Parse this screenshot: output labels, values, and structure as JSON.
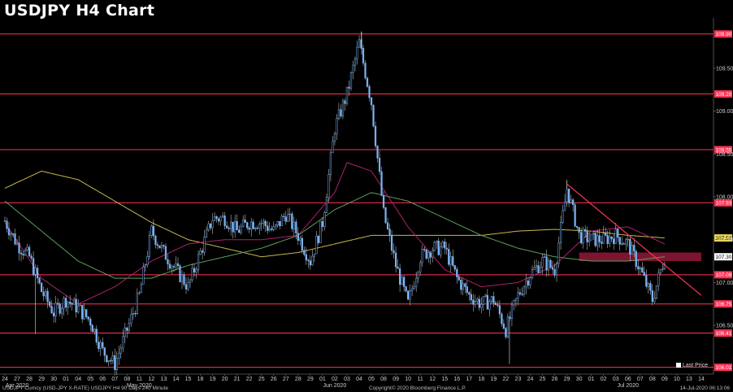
{
  "header": {
    "title": "USDJPY H4 Chart"
  },
  "footer": {
    "left": "USDJPY Curncy (USD-JPY X-RATE) USDJPY H4 90 Days 240 Minute",
    "mid": "Copyright© 2020 Bloomberg Finance L.P.",
    "right": "14-Jul-2020 06:13:06"
  },
  "legend": {
    "last_price": "Last Price"
  },
  "colors": {
    "candle": "#7ab3f5",
    "level_line": "#ff3355",
    "trend_line": "#ff3355",
    "ma_yellow": "#c8b84a",
    "ma_green": "#5c9e5c",
    "ma_magenta": "#b0206a",
    "zone": "#c0204a",
    "badge_yellow": "#e8d84a",
    "badge_white": "#ffffff"
  },
  "chart_data": {
    "type": "candlestick",
    "title": "USDJPY H4 Chart",
    "ylim": [
      105.95,
      110.05
    ],
    "y_ticks": [
      "109.50",
      "109.00",
      "108.50",
      "108.00",
      "107.50",
      "107.00",
      "106.50"
    ],
    "levels": [
      {
        "value": 109.9,
        "label": "109.90"
      },
      {
        "value": 109.2,
        "label": "109.20"
      },
      {
        "value": 108.55,
        "label": "108.55"
      },
      {
        "value": 107.93,
        "label": "107.93"
      },
      {
        "value": 107.09,
        "label": "107.09"
      },
      {
        "value": 106.75,
        "label": "106.75"
      },
      {
        "value": 106.41,
        "label": "106.41"
      },
      {
        "value": 106.01,
        "label": "106.01"
      }
    ],
    "badges": [
      {
        "value": 107.52,
        "label": "107.52",
        "color": "badge_yellow"
      },
      {
        "value": 107.3,
        "label": "107.30",
        "color": "badge_white"
      }
    ],
    "x_ticks": [
      "24",
      "27",
      "28",
      "29",
      "30",
      "01",
      "04",
      "05",
      "06",
      "07",
      "08",
      "11",
      "12",
      "13",
      "14",
      "15",
      "18",
      "19",
      "20",
      "21",
      "22",
      "25",
      "26",
      "27",
      "28",
      "29",
      "01",
      "02",
      "03",
      "04",
      "05",
      "08",
      "09",
      "10",
      "11",
      "12",
      "15",
      "16",
      "17",
      "18",
      "19",
      "22",
      "23",
      "24",
      "25",
      "26",
      "29",
      "30",
      "01",
      "02",
      "03",
      "06",
      "07",
      "08",
      "09",
      "10",
      "13",
      "14"
    ],
    "months": [
      {
        "label": "Apr 2020",
        "index": 1
      },
      {
        "label": "May 2020",
        "index": 11
      },
      {
        "label": "Jun 2020",
        "index": 27
      },
      {
        "label": "Jul 2020",
        "index": 51
      }
    ],
    "price_path": [
      [
        0,
        107.72
      ],
      [
        1,
        107.45
      ],
      [
        2,
        107.3
      ],
      [
        3,
        106.9
      ],
      [
        4,
        106.65
      ],
      [
        5,
        106.8
      ],
      [
        6,
        106.7
      ],
      [
        7,
        106.55
      ],
      [
        8,
        106.2
      ],
      [
        9,
        106.05
      ],
      [
        10,
        106.45
      ],
      [
        11,
        106.85
      ],
      [
        12,
        107.6
      ],
      [
        13,
        107.35
      ],
      [
        14,
        107.15
      ],
      [
        15,
        106.95
      ],
      [
        16,
        107.35
      ],
      [
        17,
        107.75
      ],
      [
        18,
        107.75
      ],
      [
        19,
        107.6
      ],
      [
        20,
        107.7
      ],
      [
        21,
        107.7
      ],
      [
        22,
        107.6
      ],
      [
        23,
        107.8
      ],
      [
        24,
        107.55
      ],
      [
        25,
        107.25
      ],
      [
        26,
        107.7
      ],
      [
        27,
        108.8
      ],
      [
        28,
        109.2
      ],
      [
        29,
        109.8
      ],
      [
        30,
        109.1
      ],
      [
        31,
        107.8
      ],
      [
        32,
        107.2
      ],
      [
        33,
        106.75
      ],
      [
        34,
        107.3
      ],
      [
        35,
        107.4
      ],
      [
        36,
        107.4
      ],
      [
        37,
        107.05
      ],
      [
        38,
        106.85
      ],
      [
        39,
        106.75
      ],
      [
        40,
        106.8
      ],
      [
        41,
        106.45
      ],
      [
        42,
        106.85
      ],
      [
        43,
        107.1
      ],
      [
        44,
        107.25
      ],
      [
        45,
        107.15
      ],
      [
        46,
        108.1
      ],
      [
        47,
        107.55
      ],
      [
        48,
        107.5
      ],
      [
        49,
        107.5
      ],
      [
        50,
        107.55
      ],
      [
        51,
        107.45
      ],
      [
        52,
        107.15
      ],
      [
        53,
        106.8
      ],
      [
        54,
        107.3
      ]
    ],
    "ma_yellow": [
      [
        0,
        108.1
      ],
      [
        3,
        108.3
      ],
      [
        6,
        108.2
      ],
      [
        9,
        107.95
      ],
      [
        12,
        107.7
      ],
      [
        15,
        107.5
      ],
      [
        18,
        107.4
      ],
      [
        21,
        107.3
      ],
      [
        24,
        107.35
      ],
      [
        27,
        107.45
      ],
      [
        30,
        107.55
      ],
      [
        33,
        107.55
      ],
      [
        36,
        107.55
      ],
      [
        39,
        107.55
      ],
      [
        42,
        107.6
      ],
      [
        45,
        107.62
      ],
      [
        48,
        107.6
      ],
      [
        51,
        107.55
      ],
      [
        54,
        107.52
      ]
    ],
    "ma_green": [
      [
        0,
        107.95
      ],
      [
        3,
        107.6
      ],
      [
        6,
        107.25
      ],
      [
        9,
        107.05
      ],
      [
        12,
        107.05
      ],
      [
        15,
        107.2
      ],
      [
        18,
        107.3
      ],
      [
        21,
        107.4
      ],
      [
        24,
        107.55
      ],
      [
        27,
        107.85
      ],
      [
        30,
        108.05
      ],
      [
        33,
        107.95
      ],
      [
        36,
        107.75
      ],
      [
        39,
        107.55
      ],
      [
        42,
        107.4
      ],
      [
        45,
        107.3
      ],
      [
        48,
        107.25
      ],
      [
        51,
        107.25
      ],
      [
        54,
        107.3
      ]
    ],
    "ma_magenta": [
      [
        0,
        107.7
      ],
      [
        3,
        107.05
      ],
      [
        6,
        106.75
      ],
      [
        9,
        106.95
      ],
      [
        12,
        107.25
      ],
      [
        15,
        107.45
      ],
      [
        18,
        107.5
      ],
      [
        21,
        107.5
      ],
      [
        24,
        107.55
      ],
      [
        27,
        108.05
      ],
      [
        28,
        108.4
      ],
      [
        30,
        108.3
      ],
      [
        33,
        107.65
      ],
      [
        36,
        107.15
      ],
      [
        39,
        106.95
      ],
      [
        42,
        107.0
      ],
      [
        45,
        107.2
      ],
      [
        48,
        107.6
      ],
      [
        51,
        107.65
      ],
      [
        54,
        107.45
      ]
    ],
    "trendline": [
      [
        46,
        108.15
      ],
      [
        57,
        106.85
      ]
    ],
    "zone": {
      "from_index": 47,
      "to_index": 57,
      "low": 107.25,
      "high": 107.35
    }
  }
}
